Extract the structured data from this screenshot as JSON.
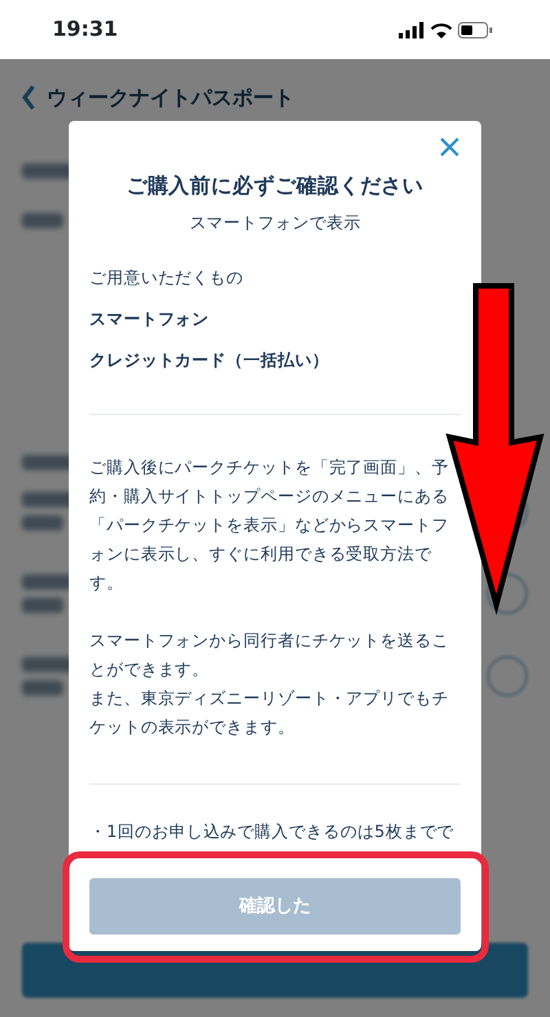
{
  "status_bar": {
    "time": "19:31"
  },
  "background_page": {
    "title": "ウィークナイトパスポート"
  },
  "dialog": {
    "title": "ご購入前に必ずご確認ください",
    "subtitle": "スマートフォンで表示",
    "section_heading": "ご用意いただくもの",
    "items": [
      "スマートフォン",
      "クレジットカード（一括払い）"
    ],
    "paragraphs": [
      [
        "ご購入後にパークチケットを「完了画面」、予約・購入サイトトップページのメニューにある「パークチケットを表示」などからスマートフォンに表示し、すぐに利用できる受取方法です。"
      ],
      [
        "スマートフォンから同行者にチケットを送ることができます。",
        "また、東京ディズニーリゾート・アプリでもチケットの表示ができます。"
      ]
    ],
    "notes": [
      "・1回のお申し込みで購入できるのは5枚までで"
    ],
    "confirm_button": {
      "label": "確認した",
      "disabled": true
    }
  },
  "annotations": {
    "arrow": true,
    "highlight": true
  }
}
